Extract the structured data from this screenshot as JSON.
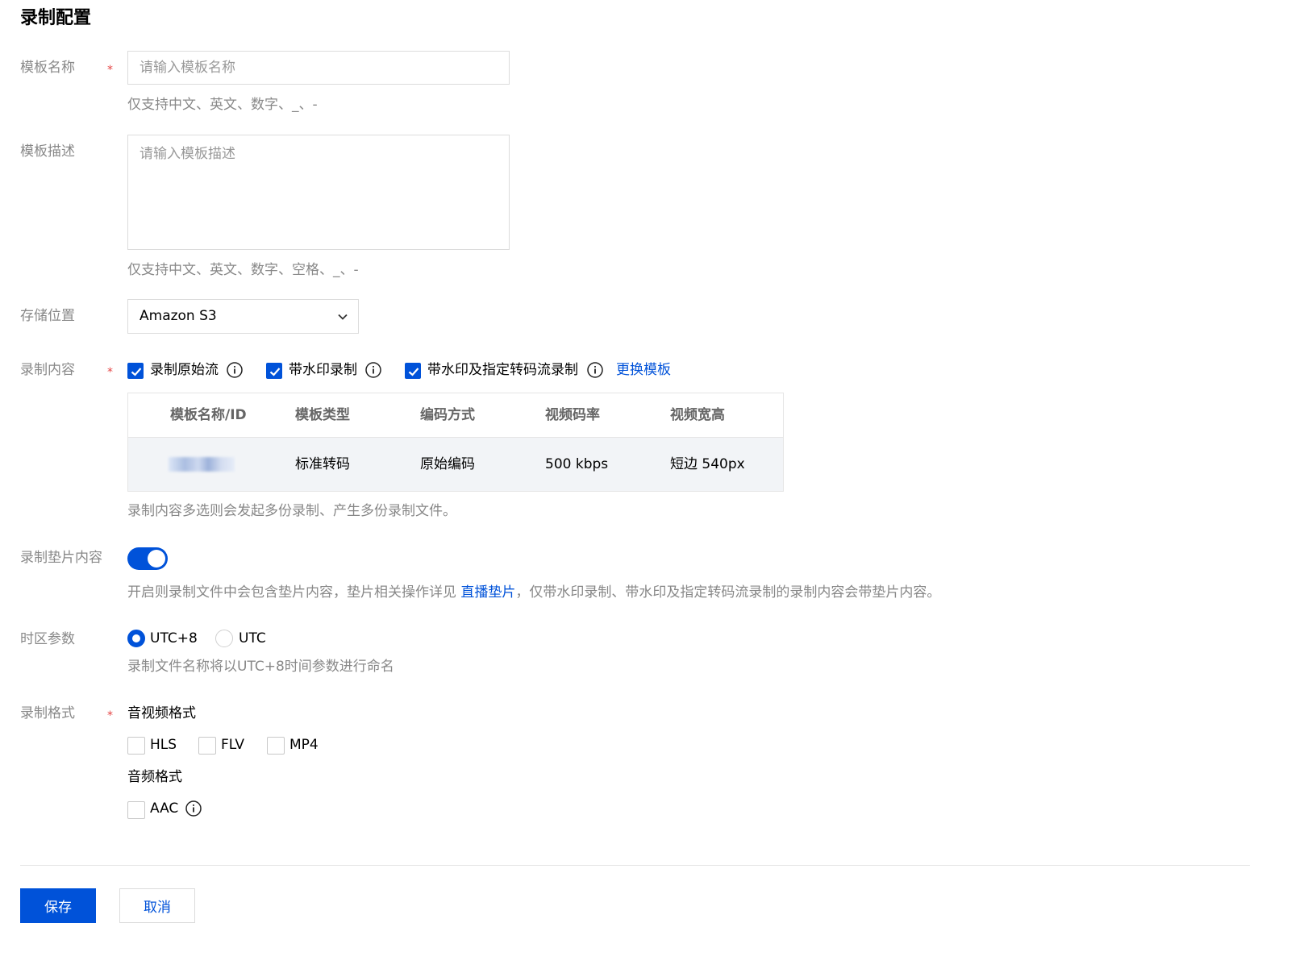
{
  "page": {
    "title": "录制配置"
  },
  "form": {
    "name": {
      "label": "模板名称",
      "required_mark": "*",
      "placeholder": "请输入模板名称",
      "hint": "仅支持中文、英文、数字、_、-"
    },
    "description": {
      "label": "模板描述",
      "placeholder": "请输入模板描述",
      "hint": "仅支持中文、英文、数字、空格、_、-"
    },
    "storage": {
      "label": "存储位置",
      "selected": "Amazon S3",
      "icon": "chevron-down-icon"
    },
    "content": {
      "label": "录制内容",
      "required_mark": "*",
      "options": [
        {
          "label": "录制原始流",
          "checked": true
        },
        {
          "label": "带水印录制",
          "checked": true
        },
        {
          "label": "带水印及指定转码流录制",
          "checked": true
        }
      ],
      "change_template_link": "更换模板",
      "table": {
        "headers": [
          "模板名称/ID",
          "模板类型",
          "编码方式",
          "视频码率",
          "视频宽高"
        ],
        "rows": [
          {
            "name_id": "",
            "type": "标准转码",
            "encoding": "原始编码",
            "bitrate": "500 kbps",
            "resolution": "短边 540px"
          }
        ]
      },
      "hint": "录制内容多选则会发起多份录制、产生多份录制文件。"
    },
    "slate": {
      "label": "录制垫片内容",
      "enabled": true,
      "hint_before": "开启则录制文件中会包含垫片内容，垫片相关操作详见",
      "hint_link": "直播垫片",
      "hint_after": "，仅带水印录制、带水印及指定转码流录制的录制内容会带垫片内容。"
    },
    "timezone": {
      "label": "时区参数",
      "options": [
        {
          "label": "UTC+8",
          "selected": true
        },
        {
          "label": "UTC",
          "selected": false
        }
      ],
      "hint": "录制文件名称将以UTC+8时间参数进行命名"
    },
    "format": {
      "label": "录制格式",
      "required_mark": "*",
      "av_title": "音视频格式",
      "av_options": [
        {
          "label": "HLS",
          "checked": false
        },
        {
          "label": "FLV",
          "checked": false
        },
        {
          "label": "MP4",
          "checked": false
        }
      ],
      "audio_title": "音频格式",
      "audio_options": [
        {
          "label": "AAC",
          "checked": false
        }
      ]
    }
  },
  "actions": {
    "save": "保存",
    "cancel": "取消"
  },
  "colors": {
    "primary": "#0052d9",
    "required": "#e54545",
    "label": "#888888"
  }
}
